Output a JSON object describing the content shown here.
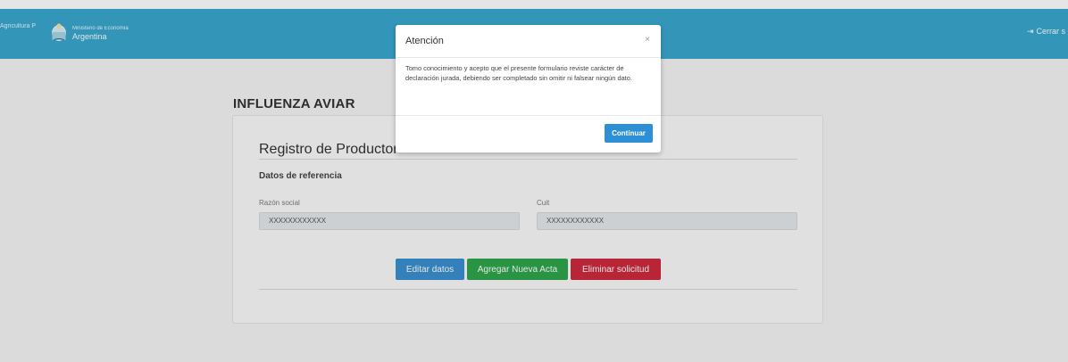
{
  "header": {
    "brand_left": "Agricultura\nPesca",
    "ministry_small": "Ministerio de Economía",
    "ministry_big": "Argentina",
    "crest_icon": "argentina-coat-of-arms-icon",
    "logout_icon": "sign-out-icon",
    "logout_label": "Cerrar s",
    "color": "#39a8cf"
  },
  "main": {
    "page_title": "INFLUENZA AVIAR",
    "card_title": "Registro de Productor",
    "section_title": "Datos de referencia",
    "fields": [
      {
        "label": "Razón social",
        "value": "XXXXXXXXXXXX"
      },
      {
        "label": "Cuit",
        "value": "XXXXXXXXXXXX"
      }
    ],
    "buttons": {
      "edit": "Editar datos",
      "add": "Agregar Nueva Acta",
      "delete": "Eliminar solicitud"
    },
    "colors": {
      "edit": "#3a8fd0",
      "add": "#2ea64c",
      "delete": "#cc2a3d"
    }
  },
  "modal": {
    "title": "Atención",
    "close_icon": "close-icon",
    "close_glyph": "×",
    "body": "Tomo conocimiento y acepto que el presente formulario reviste carácter de declaración jurada, debiendo ser completado sin omitir ni falsear ningún dato.",
    "continue_label": "Continuar",
    "continue_color": "#2d8fd5"
  }
}
